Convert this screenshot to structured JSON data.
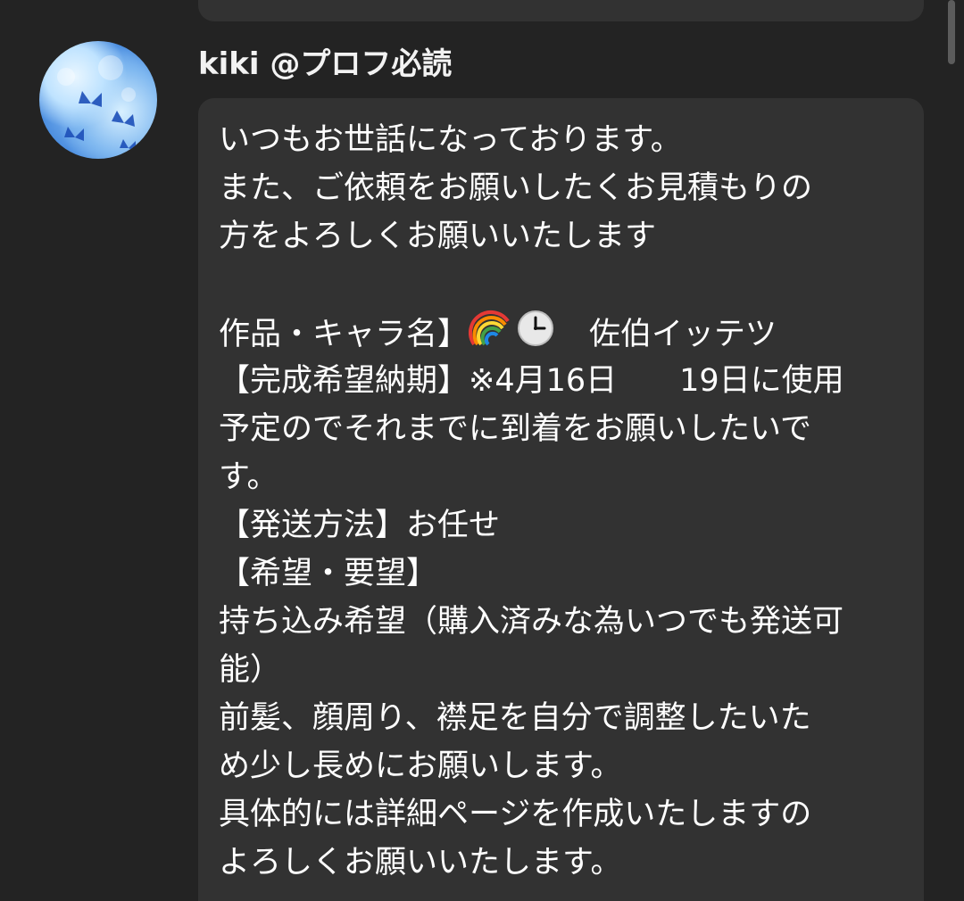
{
  "message": {
    "sender": "kiki @プロフ必読",
    "lines": [
      "いつもお世話になっております。",
      "また、ご依頼をお願いしたくお見積もりの",
      "方をよろしくお願いいたします",
      "",
      "作品・キャラ名】",
      "【完成希望納期】※4月16日　　19日に使用",
      "予定のでそれまでに到着をお願いしたいで",
      "す。",
      "【発送方法】お任せ",
      "【希望・要望】",
      "持ち込み希望（購入済みな為いつでも発送可",
      "能）",
      "前髪、顔周り、襟足を自分で調整したいた",
      "め少し長めにお願いします。",
      "具体的には詳細ページを作成いたしますの",
      "よろしくお願いいたします。"
    ],
    "line4_suffix": "　佐伯イッテツ",
    "emojis": [
      "rainbow-icon",
      "clock-icon"
    ]
  },
  "colors": {
    "background": "#232323",
    "bubble": "#323232",
    "text": "#ffffff",
    "scrollbar": "#5c5c5c"
  }
}
